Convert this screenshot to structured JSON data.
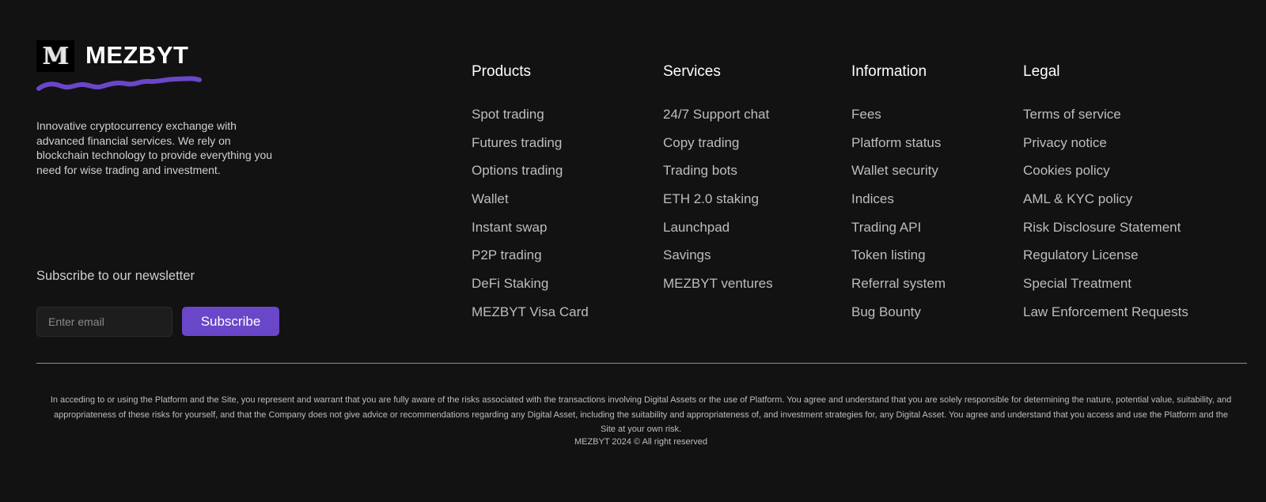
{
  "brand": {
    "logo_letter": "M",
    "name": "MEZBYT",
    "accent_color": "#6a46c9",
    "tagline": "Innovative cryptocurrency exchange with advanced financial services. We rely on blockchain technology to provide everything you need for wise trading and investment."
  },
  "newsletter": {
    "title": "Subscribe to our newsletter",
    "email_placeholder": "Enter email",
    "email_value": "",
    "button_label": "Subscribe"
  },
  "columns": {
    "products": {
      "title": "Products",
      "links": [
        "Spot trading",
        "Futures trading",
        "Options trading",
        "Wallet",
        "Instant swap",
        "P2P trading",
        "DeFi Staking",
        "MEZBYT Visa Card"
      ]
    },
    "services": {
      "title": "Services",
      "links": [
        "24/7 Support chat",
        "Copy trading",
        "Trading bots",
        "ETH 2.0 staking",
        "Launchpad",
        "Savings",
        "MEZBYT ventures"
      ]
    },
    "information": {
      "title": "Information",
      "links": [
        "Fees",
        "Platform status",
        "Wallet security",
        "Indices",
        "Trading API",
        "Token listing",
        "Referral system",
        "Bug Bounty"
      ]
    },
    "legal": {
      "title": "Legal",
      "links": [
        "Terms of service",
        "Privacy notice",
        "Cookies policy",
        "AML & KYC policy",
        "Risk Disclosure Statement",
        "Regulatory License",
        "Special Treatment",
        "Law Enforcement Requests"
      ]
    }
  },
  "disclaimer": "In acceding to or using the Platform and the Site, you represent and warrant that you are fully aware of the risks associated with the transactions involving Digital Assets or the use of Platform. You agree and understand that you are solely responsible for determining the nature, potential value, suitability, and appropriateness of these risks for yourself, and that the Company does not give advice or recommendations regarding any Digital Asset, including the suitability and appropriateness of, and investment strategies for, any Digital Asset. You agree and understand that you access and use the Platform and the Site at your own risk.",
  "copyright": "MEZBYT 2024 © All right reserved"
}
